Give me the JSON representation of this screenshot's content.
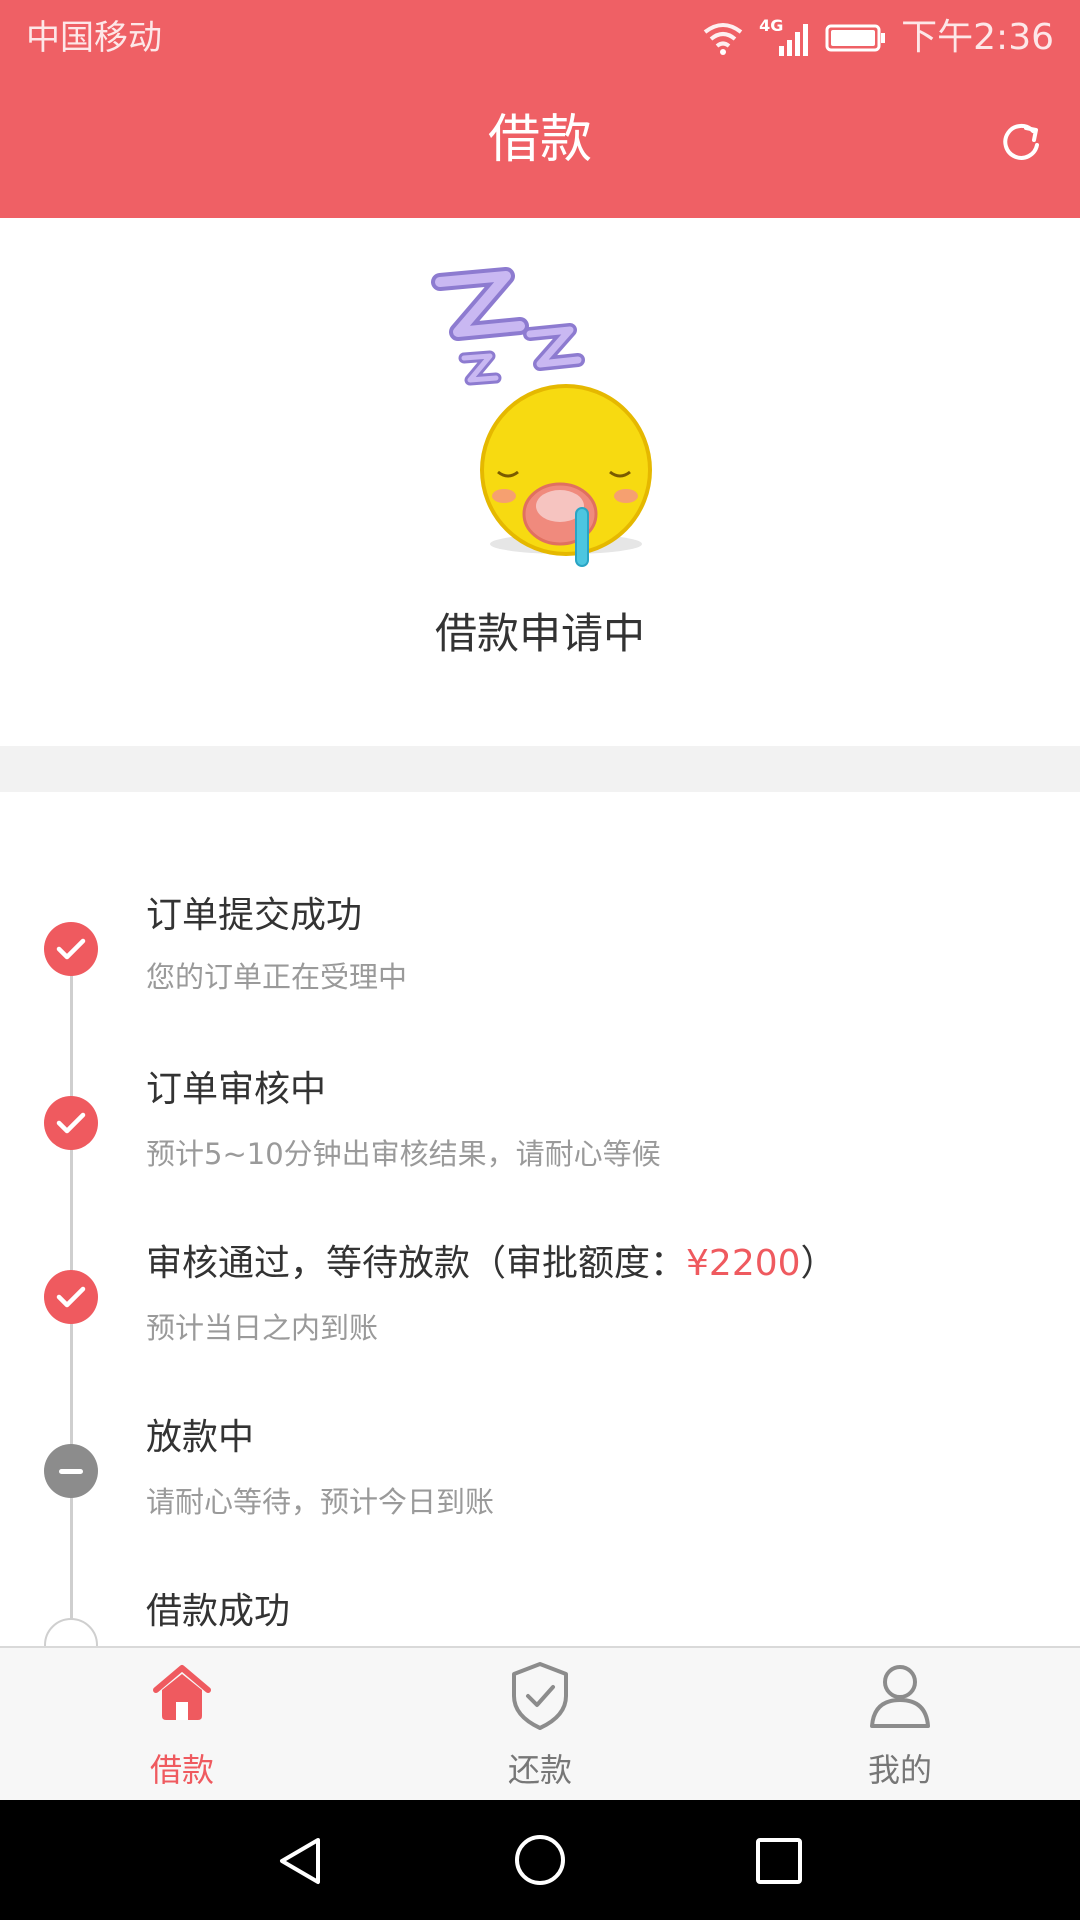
{
  "status_bar": {
    "carrier": "中国移动",
    "network": "4G",
    "time": "下午2:36"
  },
  "header": {
    "title": "借款",
    "refresh_icon": "refresh-icon"
  },
  "hero": {
    "illustration": "sleeping-emoji",
    "status_text": "借款申请中"
  },
  "timeline": {
    "steps": [
      {
        "title": "订单提交成功",
        "desc": "您的订单正在受理中",
        "state": "done"
      },
      {
        "title": "订单审核中",
        "desc": "预计5~10分钟出审核结果，请耐心等候",
        "state": "done"
      },
      {
        "title_prefix": "审核通过，等待放款（审批额度：",
        "amount": "¥2200",
        "title_suffix": "）",
        "desc": "预计当日之内到账",
        "state": "done"
      },
      {
        "title": "放款中",
        "desc": "请耐心等待，预计今日到账",
        "state": "current"
      },
      {
        "title": "借款成功",
        "state": "pending"
      }
    ]
  },
  "bottom_nav": {
    "items": [
      {
        "label": "借款",
        "icon": "home-icon",
        "active": true
      },
      {
        "label": "还款",
        "icon": "shield-check-icon",
        "active": false
      },
      {
        "label": "我的",
        "icon": "user-icon",
        "active": false
      }
    ]
  },
  "colors": {
    "brand": "#ef6065",
    "accent_text": "#ef5a5f",
    "current_step": "#8c8c8c"
  }
}
